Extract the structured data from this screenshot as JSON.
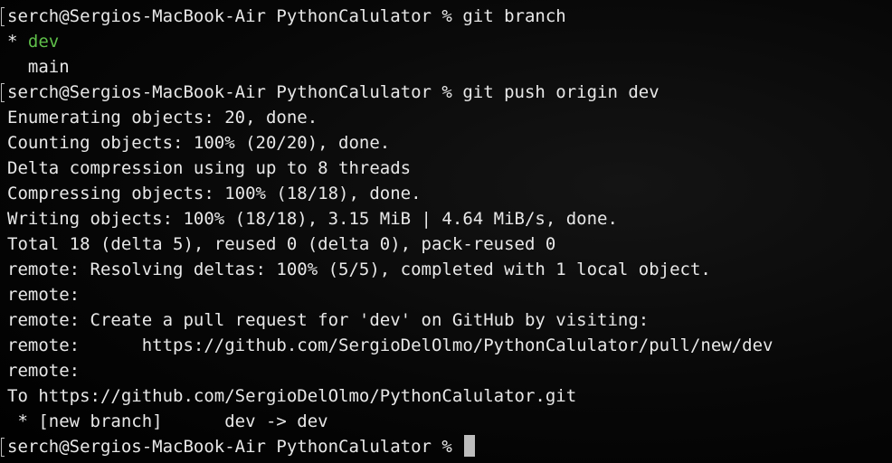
{
  "colors": {
    "background": "#000000",
    "text": "#e8e8e8",
    "current_branch": "#5fbf4a",
    "cursor": "#bdbdbd"
  },
  "terminal": {
    "lines": [
      {
        "type": "prompt",
        "prompt": "serch@Sergios-MacBook-Air PythonCalulator % ",
        "command": "git branch"
      },
      {
        "type": "branch",
        "marker": "* ",
        "name": "dev",
        "current": true
      },
      {
        "type": "branch",
        "marker": "  ",
        "name": "main",
        "current": false
      },
      {
        "type": "prompt",
        "prompt": "serch@Sergios-MacBook-Air PythonCalulator % ",
        "command": "git push origin dev"
      },
      {
        "type": "output",
        "text": "Enumerating objects: 20, done."
      },
      {
        "type": "output",
        "text": "Counting objects: 100% (20/20), done."
      },
      {
        "type": "output",
        "text": "Delta compression using up to 8 threads"
      },
      {
        "type": "output",
        "text": "Compressing objects: 100% (18/18), done."
      },
      {
        "type": "output",
        "text": "Writing objects: 100% (18/18), 3.15 MiB | 4.64 MiB/s, done."
      },
      {
        "type": "output",
        "text": "Total 18 (delta 5), reused 0 (delta 0), pack-reused 0"
      },
      {
        "type": "output",
        "text": "remote: Resolving deltas: 100% (5/5), completed with 1 local object."
      },
      {
        "type": "output",
        "text": "remote:"
      },
      {
        "type": "output",
        "text": "remote: Create a pull request for 'dev' on GitHub by visiting:"
      },
      {
        "type": "output",
        "text": "remote:      https://github.com/SergioDelOlmo/PythonCalulator/pull/new/dev"
      },
      {
        "type": "output",
        "text": "remote:"
      },
      {
        "type": "output",
        "text": "To https://github.com/SergioDelOlmo/PythonCalulator.git"
      },
      {
        "type": "output",
        "text": " * [new branch]      dev -> dev"
      },
      {
        "type": "prompt",
        "prompt": "serch@Sergios-MacBook-Air PythonCalulator % ",
        "command": "",
        "cursor": true
      }
    ]
  }
}
